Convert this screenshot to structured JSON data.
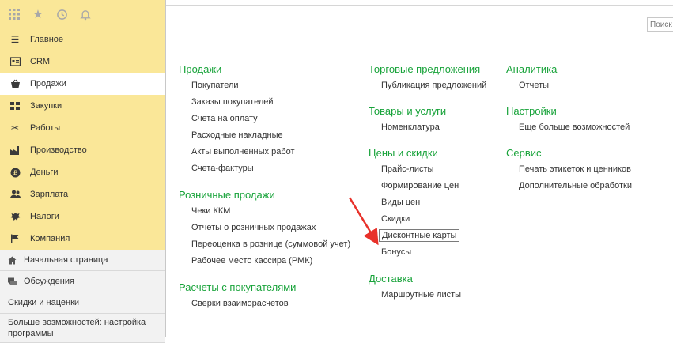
{
  "sidebar": {
    "top_icons": [
      "grid-icon",
      "star-icon",
      "history-icon",
      "bell-icon"
    ],
    "sections": [
      {
        "label": "Главное",
        "icon": "menu-lines-icon"
      },
      {
        "label": "CRM",
        "icon": "crm-icon"
      },
      {
        "label": "Продажи",
        "icon": "basket-icon"
      },
      {
        "label": "Закупки",
        "icon": "purchases-icon"
      },
      {
        "label": "Работы",
        "icon": "tools-icon"
      },
      {
        "label": "Производство",
        "icon": "factory-icon"
      },
      {
        "label": "Деньги",
        "icon": "money-icon"
      },
      {
        "label": "Зарплата",
        "icon": "people-icon"
      },
      {
        "label": "Налоги",
        "icon": "emblem-icon"
      },
      {
        "label": "Компания",
        "icon": "flag-icon"
      }
    ],
    "bottom": [
      {
        "label": "Начальная страница",
        "icon": "home-icon"
      },
      {
        "label": "Обсуждения",
        "icon": "chat-icon"
      },
      {
        "label": "Скидки и наценки"
      },
      {
        "label": "Больше возможностей: настройка программы"
      }
    ]
  },
  "search": {
    "placeholder": "Поиск"
  },
  "columns": [
    {
      "groups": [
        {
          "title": "Продажи",
          "items": [
            "Покупатели",
            "Заказы покупателей",
            "Счета на оплату",
            "Расходные накладные",
            "Акты выполненных работ",
            "Счета-фактуры"
          ]
        },
        {
          "title": "Розничные продажи",
          "items": [
            "Чеки ККМ",
            "Отчеты о розничных продажах",
            "Переоценка в рознице (суммовой учет)",
            "Рабочее место кассира (РМК)"
          ]
        },
        {
          "title": "Расчеты с покупателями",
          "items": [
            "Сверки взаиморасчетов"
          ]
        }
      ]
    },
    {
      "groups": [
        {
          "title": "Торговые предложения",
          "items": [
            "Публикация предложений"
          ]
        },
        {
          "title": "Товары и услуги",
          "items": [
            "Номенклатура"
          ]
        },
        {
          "title": "Цены и скидки",
          "items": [
            "Прайс-листы",
            "Формирование цен",
            "Виды цен",
            "Скидки",
            "Дисконтные карты",
            "Бонусы"
          ]
        },
        {
          "title": "Доставка",
          "items": [
            "Маршрутные листы"
          ]
        }
      ]
    },
    {
      "groups": [
        {
          "title": "Аналитика",
          "items": [
            "Отчеты"
          ]
        },
        {
          "title": "Настройки",
          "items": [
            "Еще больше возможностей"
          ]
        },
        {
          "title": "Сервис",
          "items": [
            "Печать этикеток и ценников",
            "Дополнительные обработки"
          ]
        }
      ]
    }
  ],
  "colors": {
    "accent_green": "#18a33a",
    "sidebar_yellow": "#fae798",
    "arrow_red": "#e8312a"
  }
}
